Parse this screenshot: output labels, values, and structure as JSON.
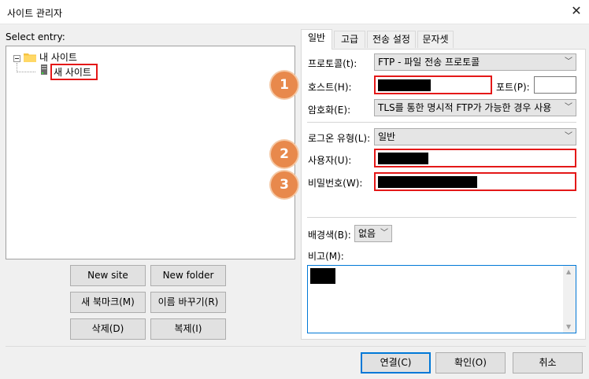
{
  "window": {
    "title": "사이트 관리자",
    "close_glyph": "✕"
  },
  "left": {
    "select_entry_label": "Select entry:",
    "tree": {
      "root_label": "내 사이트",
      "child_label": "새 사이트"
    },
    "buttons": {
      "new_site": "New site",
      "new_folder": "New folder",
      "new_bookmark": "새 북마크(M)",
      "rename": "이름 바꾸기(R)",
      "delete": "삭제(D)",
      "duplicate": "복제(I)"
    }
  },
  "tabs": [
    "일반",
    "고급",
    "전송 설정",
    "문자셋"
  ],
  "general": {
    "protocol_label": "프로토콜(t):",
    "protocol_value": "FTP - 파일 전송 프로토콜",
    "host_label": "호스트(H):",
    "port_label": "포트(P):",
    "encryption_label": "암호화(E):",
    "encryption_value": "TLS를 통한 명시적 FTP가 가능한 경우 사용",
    "logon_type_label": "로그온 유형(L):",
    "logon_type_value": "일반",
    "user_label": "사용자(U):",
    "password_label": "비밀번호(W):",
    "bg_color_label": "배경색(B):",
    "bg_color_value": "없음",
    "comments_label": "비고(M):"
  },
  "badges": [
    "1",
    "2",
    "3"
  ],
  "footer": {
    "connect": "연결(C)",
    "ok": "확인(O)",
    "cancel": "취소"
  },
  "colors": {
    "highlight_red": "#e41818",
    "badge_orange": "#e8894c",
    "accent": "#0078d7"
  }
}
